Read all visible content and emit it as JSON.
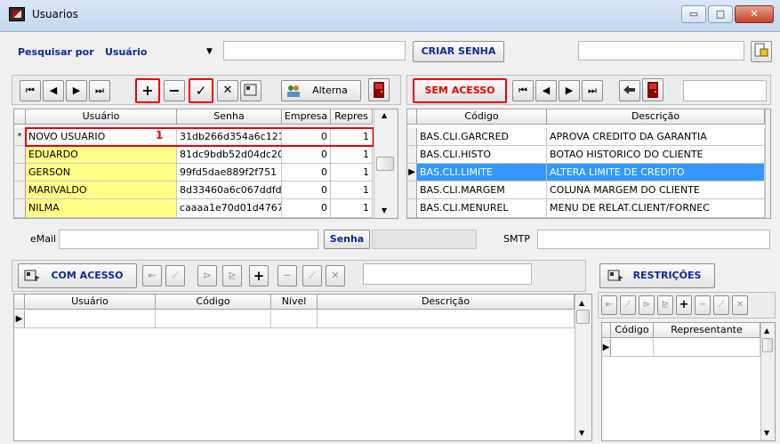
{
  "window": {
    "title": "Usuarios",
    "min": "▭",
    "max": "□",
    "close": "✕"
  },
  "search": {
    "label": "Pesquisar por",
    "field": "Usuário",
    "arrow": "▼",
    "value": "",
    "create_password": "CRIAR SENHA",
    "right_value": ""
  },
  "users_toolbar": {
    "first": "⏮",
    "prev": "◀",
    "next": "▶",
    "last": "⏭",
    "add": "+",
    "remove": "−",
    "confirm": "✓",
    "cancel": "✕",
    "alterna": "Alterna"
  },
  "users_grid": {
    "columns": [
      "Usuário",
      "Senha",
      "Empresa",
      "Repres"
    ],
    "rows": [
      {
        "ind": "*",
        "usuario": "NOVO USUARIO",
        "senha": "31db266d354a6c121",
        "empresa": "0",
        "repres": "1"
      },
      {
        "ind": "",
        "usuario": "EDUARDO",
        "senha": "81dc9bdb52d04dc20",
        "empresa": "0",
        "repres": "1"
      },
      {
        "ind": "",
        "usuario": "GERSON",
        "senha": "99fd5dae889f2f751",
        "empresa": "0",
        "repres": "1"
      },
      {
        "ind": "",
        "usuario": "MARIVALDO",
        "senha": "8d33460a6c067ddfd",
        "empresa": "0",
        "repres": "1"
      },
      {
        "ind": "",
        "usuario": "NILMA",
        "senha": "caaaa1e70d01d4767",
        "empresa": "0",
        "repres": "1"
      }
    ],
    "annotation": "1"
  },
  "sem_acesso": {
    "button": "SEM ACESSO",
    "search_value": ""
  },
  "perm_grid": {
    "columns": [
      "Código",
      "Descrição"
    ],
    "rows": [
      {
        "ind": "",
        "codigo": "BAS.CLI.GARCRED",
        "descricao": "APROVA CREDITO DA GARANTIA"
      },
      {
        "ind": "",
        "codigo": "BAS.CLI.HISTO",
        "descricao": "BOTAO HISTORICO DO CLIENTE"
      },
      {
        "ind": "▶",
        "codigo": "BAS.CLI.LIMITE",
        "descricao": "ALTERA LIMITE DE CREDITO"
      },
      {
        "ind": "",
        "codigo": "BAS.CLI.MARGEM",
        "descricao": "COLUNA MARGEM DO CLIENTE"
      },
      {
        "ind": "",
        "codigo": "BAS.CLI.MENUREL",
        "descricao": "MENU DE RELAT.CLIENT/FORNEC"
      }
    ]
  },
  "email": {
    "label": "eMail",
    "value": "",
    "senha_button": "Senha",
    "senha_value": "",
    "smtp_label": "SMTP",
    "smtp_value": ""
  },
  "com_acesso": {
    "button": "COM ACESSO",
    "search_value": "",
    "columns": [
      "Usuário",
      "Código",
      "Nível",
      "Descrição"
    ],
    "row_ind": "▶"
  },
  "restricoes": {
    "button": "RESTRIÇÕES",
    "columns": [
      "Código",
      "Representante"
    ],
    "row_ind": "▶"
  },
  "colors": {
    "accent": "#3399ff",
    "highlight": "#ffff88",
    "annotation": "#e00000",
    "label_blue": "#0b2a9e"
  }
}
